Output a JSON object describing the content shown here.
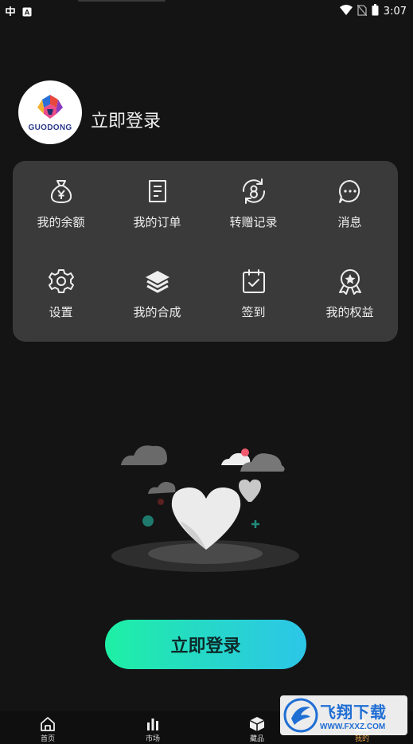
{
  "status_bar": {
    "time": "3:07",
    "left_icons": [
      "app-icon",
      "a-icon"
    ],
    "right_icons": [
      "wifi-icon",
      "no-sim-icon",
      "battery-icon"
    ]
  },
  "profile": {
    "avatar_text": "GUODONG",
    "login_link": "立即登录"
  },
  "menu": {
    "items": [
      {
        "label": "我的余额",
        "icon": "money-bag-icon"
      },
      {
        "label": "我的订单",
        "icon": "order-icon"
      },
      {
        "label": "转赠记录",
        "icon": "transfer-icon"
      },
      {
        "label": "消息",
        "icon": "message-icon"
      },
      {
        "label": "设置",
        "icon": "gear-icon"
      },
      {
        "label": "我的合成",
        "icon": "layers-icon"
      },
      {
        "label": "签到",
        "icon": "checkin-icon"
      },
      {
        "label": "我的权益",
        "icon": "award-icon"
      }
    ]
  },
  "login_button": "立即登录",
  "bottom_nav": {
    "items": [
      {
        "label": "首页",
        "icon": "home-icon"
      },
      {
        "label": "市场",
        "icon": "chart-icon"
      },
      {
        "label": "藏品",
        "icon": "box-icon"
      },
      {
        "label": "我的",
        "icon": "profile-icon",
        "active": true
      }
    ]
  },
  "watermark": {
    "cn": "飞翔下载",
    "url": "WWW.FXXZ.COM"
  },
  "colors": {
    "background": "#141414",
    "card": "#3a3a3a",
    "button_gradient_start": "#1ef0a4",
    "button_gradient_end": "#2cc6e8",
    "nav_active": "#e8a14c"
  }
}
